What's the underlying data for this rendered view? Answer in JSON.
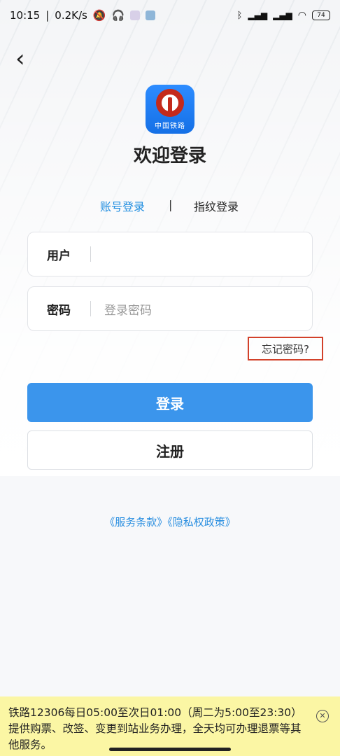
{
  "status_bar": {
    "time": "10:15",
    "speed": "0.2K/s",
    "battery": "74",
    "icons": [
      "mute-bell-icon",
      "headphones-icon",
      "app-icon",
      "app-icon",
      "bluetooth-icon",
      "signal-icon",
      "signal-icon",
      "wifi-icon",
      "battery-icon"
    ]
  },
  "header": {
    "back_icon": "chevron-left-icon",
    "back_glyph": "‹"
  },
  "logo": {
    "text": "中国铁路"
  },
  "welcome": "欢迎登录",
  "tabs": {
    "account": "账号登录",
    "separator": "|",
    "fingerprint": "指纹登录"
  },
  "form": {
    "user_label": "用户",
    "user_value": "",
    "password_label": "密码",
    "password_placeholder": "登录密码"
  },
  "forgot_password": "忘记密码?",
  "buttons": {
    "login": "登录",
    "register": "注册"
  },
  "terms": "《服务条款》《隐私权政策》",
  "notice": {
    "text": "铁路12306每日05:00至次日01:00（周二为5:00至23:30）提供购票、改签、变更到站业务办理，全天均可办理退票等其他服务。",
    "close_glyph": "✕"
  },
  "colors": {
    "accent": "#3b95ec",
    "link": "#2b8fe0",
    "highlight_border": "#d2412a",
    "notice_bg": "#fbf6a4"
  }
}
